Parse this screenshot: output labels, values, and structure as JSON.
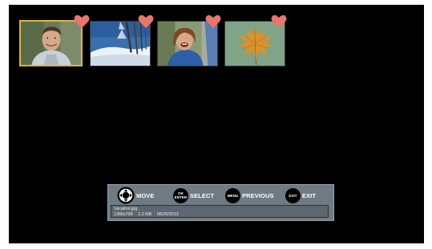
{
  "thumbnails": [
    {
      "subject": "smiling young man",
      "selected": true,
      "favorite": true
    },
    {
      "subject": "snowy landscape with trees",
      "selected": false,
      "favorite": true
    },
    {
      "subject": "laughing woman",
      "selected": false,
      "favorite": true
    },
    {
      "subject": "autumn maple leaf",
      "selected": false,
      "favorite": true
    }
  ],
  "controls": {
    "move": {
      "label": "MOVE"
    },
    "select": {
      "label": "SELECT",
      "button_text": [
        "OK",
        "ENTER"
      ]
    },
    "previous": {
      "label": "PREVIOUS",
      "button_text": [
        "MENU"
      ]
    },
    "exit": {
      "label": "EXIT",
      "button_text": [
        "EXIT"
      ]
    }
  },
  "file_info": {
    "filename": "Vacation.jpg",
    "resolution": "1366x768",
    "size": "1.2 MB",
    "date": "08/20/2013"
  },
  "colors": {
    "screen_bg": "#000000",
    "selection_border": "#d8b83a",
    "heart": "#e9756b",
    "control_bar": "#707a83"
  }
}
